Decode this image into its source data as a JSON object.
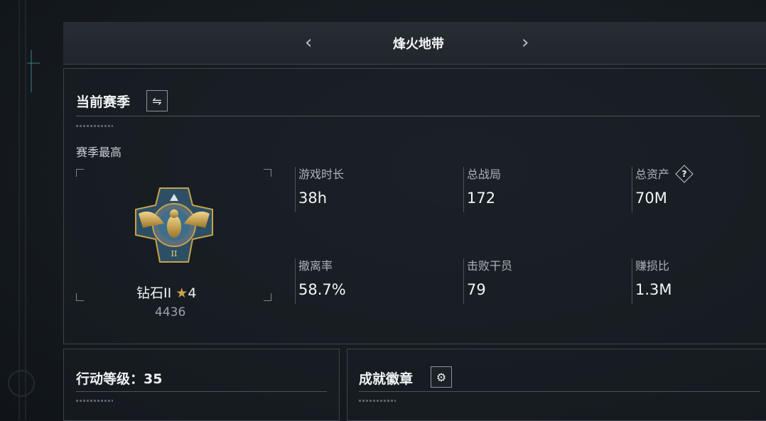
{
  "header": {
    "prev_icon": "chevron-left-icon",
    "title": "烽火地带",
    "next_icon": "chevron-right-icon"
  },
  "season": {
    "title": "当前赛季",
    "swap_icon": "swap-icon",
    "best_label": "赛季最高",
    "rank": {
      "name": "钻石II",
      "stars": "4",
      "star_icon": "star-icon",
      "score": "4436",
      "badge_icon": "eagle-rank-badge-icon"
    },
    "stats": [
      {
        "label": "游戏时长",
        "value": "38h"
      },
      {
        "label": "总战局",
        "value": "172"
      },
      {
        "label": "总资产",
        "value": "70M",
        "help_icon": "question-icon"
      },
      {
        "label": "撤离率",
        "value": "58.7%"
      },
      {
        "label": "击败干员",
        "value": "79"
      },
      {
        "label": "赚损比",
        "value": "1.3M"
      }
    ]
  },
  "level": {
    "title": "行动等级：35"
  },
  "badges": {
    "title": "成就徽章",
    "settings_icon": "gear-icon"
  },
  "colors": {
    "background": "#151a1f",
    "panel_border": "#3b444c",
    "text_primary": "#f0f3f5",
    "text_secondary": "#aab2b9",
    "gold": "#c9a24a",
    "badge_blue": "#3f6e8c"
  }
}
